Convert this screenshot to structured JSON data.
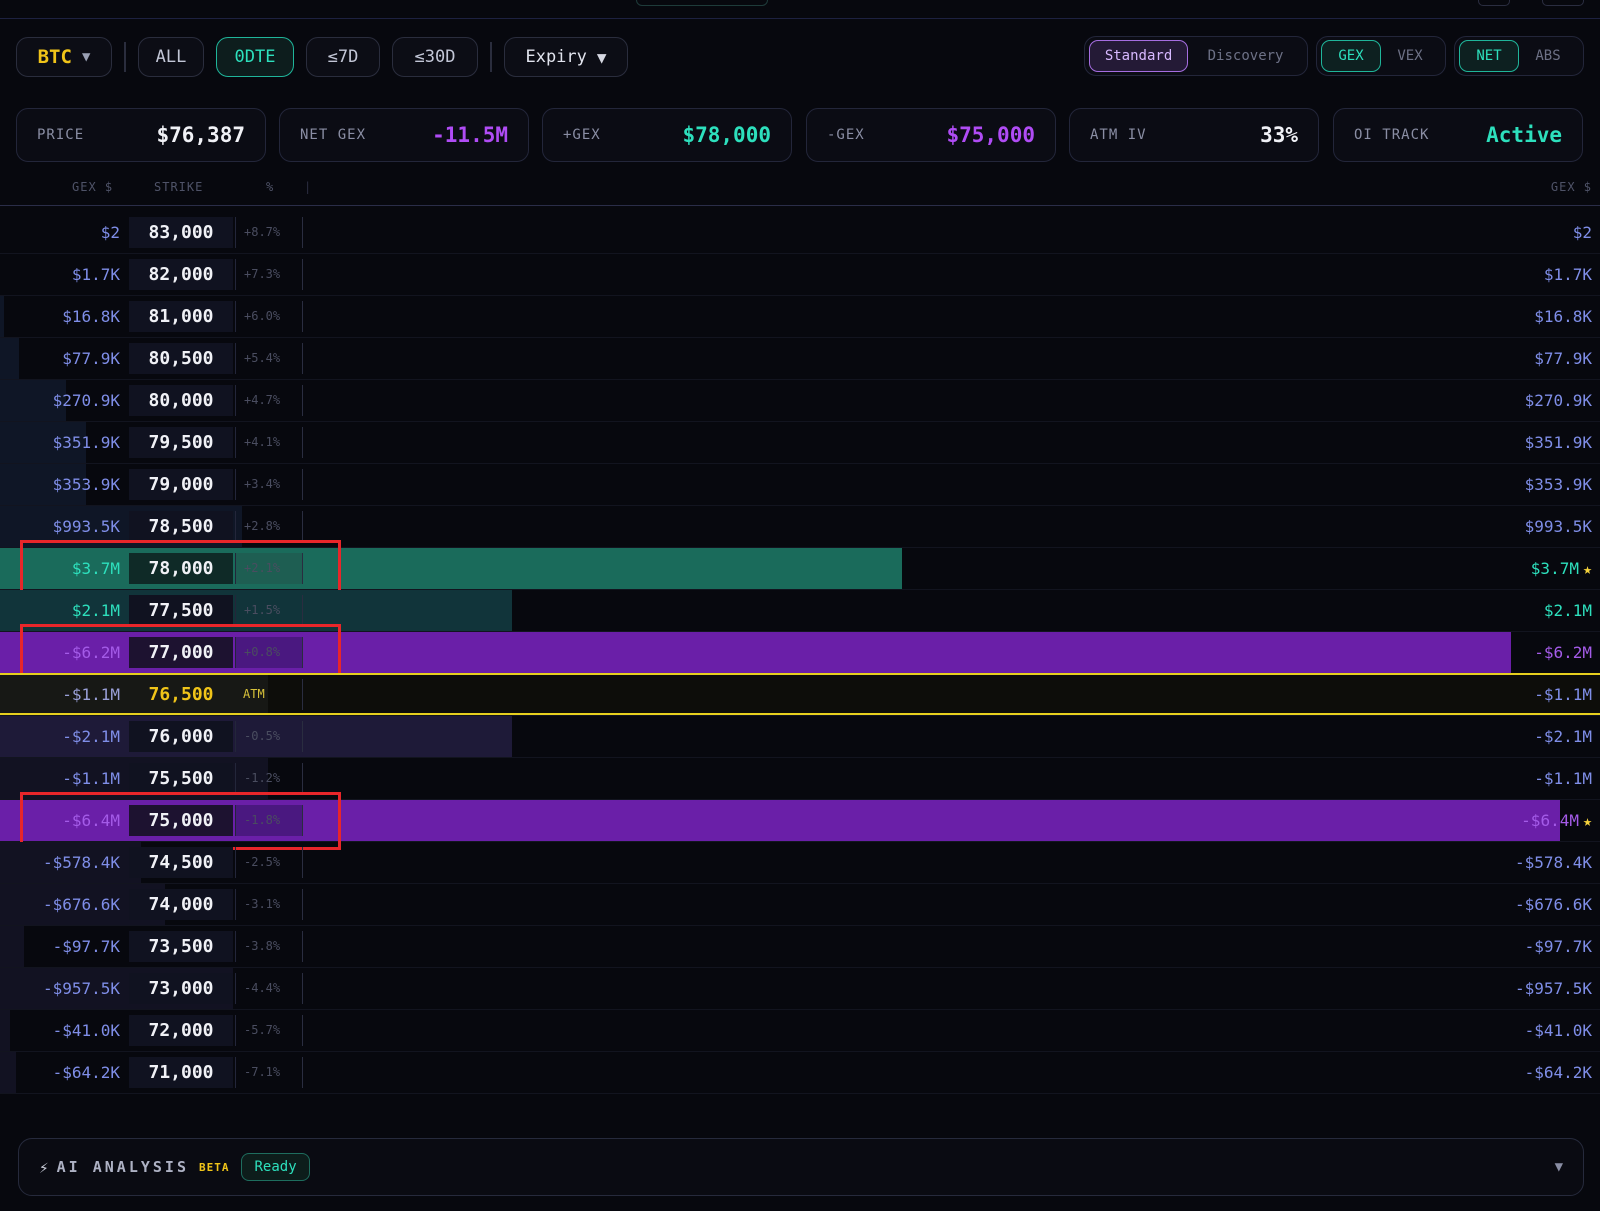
{
  "toolbar": {
    "coin": "BTC",
    "expiry_filters": [
      "ALL",
      "0DTE",
      "≤7D",
      "≤30D"
    ],
    "active_filter": "0DTE",
    "expiry_label": "Expiry"
  },
  "mode_toggle": {
    "options": [
      "Standard",
      "Discovery"
    ],
    "selected": "Standard"
  },
  "metric_toggle": {
    "options": [
      "GEX",
      "VEX"
    ],
    "selected": "GEX"
  },
  "agg_toggle": {
    "options": [
      "NET",
      "ABS"
    ],
    "selected": "NET"
  },
  "stats": [
    {
      "label": "PRICE",
      "value": "$76,387",
      "color": "#f0f1f6"
    },
    {
      "label": "NET GEX",
      "value": "-11.5M",
      "color": "#b04cf5"
    },
    {
      "label": "+GEX",
      "value": "$78,000",
      "color": "#2de0bd"
    },
    {
      "label": "-GEX",
      "value": "$75,000",
      "color": "#b04cf5"
    },
    {
      "label": "ATM IV",
      "value": "33%",
      "color": "#f0f1f6"
    },
    {
      "label": "OI TRACK",
      "value": "Active",
      "color": "#2de0bd"
    }
  ],
  "table": {
    "headers": {
      "gex_left": "GEX $",
      "strike": "STRIKE",
      "pct": "%",
      "gex_right": "GEX $"
    },
    "rows": [
      {
        "gex": "$2",
        "strike": "83,000",
        "pct": "+8.7%",
        "net_gex_usd": 2
      },
      {
        "gex": "$1.7K",
        "strike": "82,000",
        "pct": "+7.3%",
        "net_gex_usd": 1700
      },
      {
        "gex": "$16.8K",
        "strike": "81,000",
        "pct": "+6.0%",
        "net_gex_usd": 16800
      },
      {
        "gex": "$77.9K",
        "strike": "80,500",
        "pct": "+5.4%",
        "net_gex_usd": 77900
      },
      {
        "gex": "$270.9K",
        "strike": "80,000",
        "pct": "+4.7%",
        "net_gex_usd": 270900
      },
      {
        "gex": "$351.9K",
        "strike": "79,500",
        "pct": "+4.1%",
        "net_gex_usd": 351900
      },
      {
        "gex": "$353.9K",
        "strike": "79,000",
        "pct": "+3.4%",
        "net_gex_usd": 353900
      },
      {
        "gex": "$993.5K",
        "strike": "78,500",
        "pct": "+2.8%",
        "net_gex_usd": 993500
      },
      {
        "gex": "$3.7M",
        "strike": "78,000",
        "pct": "+2.1%",
        "net_gex_usd": 3700000,
        "star": true,
        "boxed": true
      },
      {
        "gex": "$2.1M",
        "strike": "77,500",
        "pct": "+1.5%",
        "net_gex_usd": 2100000
      },
      {
        "gex": "-$6.2M",
        "strike": "77,000",
        "pct": "+0.8%",
        "net_gex_usd": -6200000,
        "boxed": true
      },
      {
        "gex": "-$1.1M",
        "strike": "76,500",
        "pct": "ATM",
        "net_gex_usd": -1100000,
        "atm": true
      },
      {
        "gex": "-$2.1M",
        "strike": "76,000",
        "pct": "-0.5%",
        "net_gex_usd": -2100000
      },
      {
        "gex": "-$1.1M",
        "strike": "75,500",
        "pct": "-1.2%",
        "net_gex_usd": -1100000
      },
      {
        "gex": "-$6.4M",
        "strike": "75,000",
        "pct": "-1.8%",
        "net_gex_usd": -6400000,
        "star": true,
        "boxed": true
      },
      {
        "gex": "-$578.4K",
        "strike": "74,500",
        "pct": "-2.5%",
        "net_gex_usd": -578400
      },
      {
        "gex": "-$676.6K",
        "strike": "74,000",
        "pct": "-3.1%",
        "net_gex_usd": -676600
      },
      {
        "gex": "-$97.7K",
        "strike": "73,500",
        "pct": "-3.8%",
        "net_gex_usd": -97700
      },
      {
        "gex": "-$957.5K",
        "strike": "73,000",
        "pct": "-4.4%",
        "net_gex_usd": -957500
      },
      {
        "gex": "-$41.0K",
        "strike": "72,000",
        "pct": "-5.7%",
        "net_gex_usd": -41000
      },
      {
        "gex": "-$64.2K",
        "strike": "71,000",
        "pct": "-7.1%",
        "net_gex_usd": -64200
      }
    ]
  },
  "ai_panel": {
    "title": "AI ANALYSIS",
    "badge": "BETA",
    "status": "Ready"
  },
  "colors": {
    "positive": "#2de0bd",
    "negative": "#b04cf5",
    "positive_text": "#7f8ee8",
    "atm": "#e6cf1e",
    "box_outline": "#e8262a"
  }
}
